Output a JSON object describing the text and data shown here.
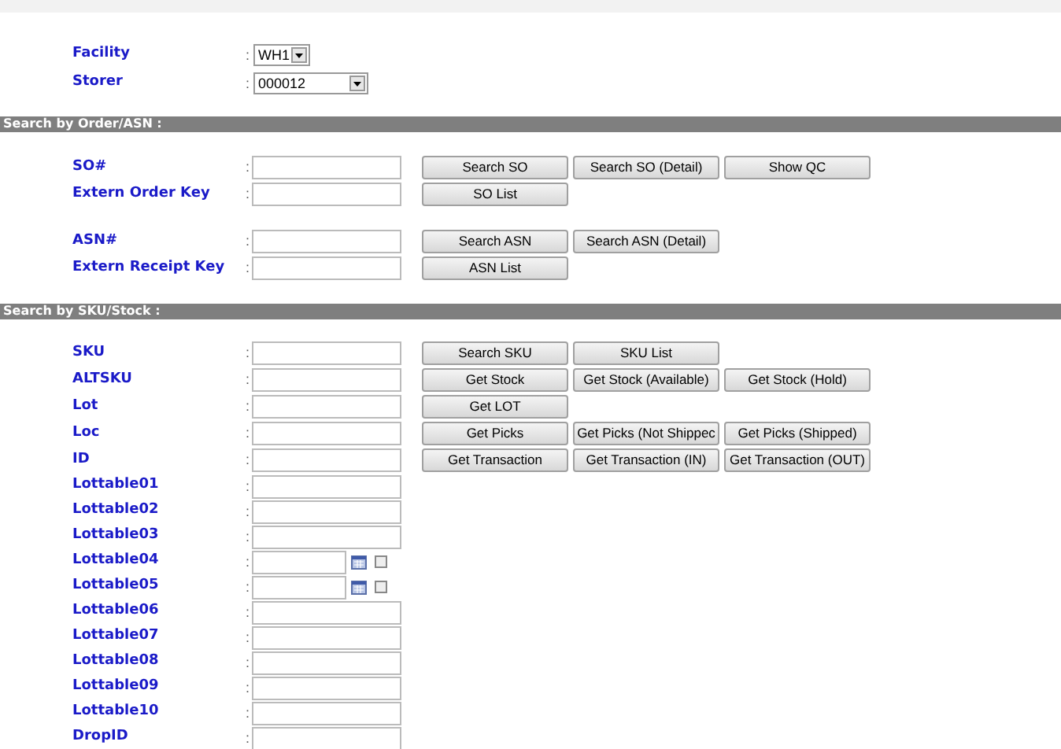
{
  "settings": [
    {
      "label": "Facility",
      "separator": ":",
      "value": "WH1"
    },
    {
      "label": "Storer",
      "separator": ":",
      "value": "000012"
    }
  ],
  "sections": [
    {
      "title": "Search by Order/ASN :",
      "groups": [
        [
          {
            "label": "SO#",
            "separator": ":",
            "kind": "text",
            "buttons": [
              "Search SO",
              "Search SO (Detail)",
              "Show QC"
            ]
          },
          {
            "label": "Extern Order Key",
            "separator": ":",
            "kind": "text",
            "buttons": [
              "SO List"
            ]
          }
        ],
        [
          {
            "label": "ASN#",
            "separator": ":",
            "kind": "text",
            "buttons": [
              "Search ASN",
              "Search ASN (Detail)"
            ]
          },
          {
            "label": "Extern Receipt Key",
            "separator": ":",
            "kind": "text",
            "buttons": [
              "ASN List"
            ]
          }
        ]
      ]
    },
    {
      "title": "Search by SKU/Stock :",
      "groups": [
        [
          {
            "label": "SKU",
            "separator": ":",
            "kind": "text",
            "buttons": [
              "Search SKU",
              "SKU List"
            ]
          },
          {
            "label": "ALTSKU",
            "separator": ":",
            "kind": "text",
            "buttons": [
              "Get Stock",
              "Get Stock (Available)",
              "Get Stock (Hold)"
            ]
          },
          {
            "label": "Lot",
            "separator": ":",
            "kind": "text",
            "buttons": [
              "Get LOT"
            ]
          },
          {
            "label": "Loc",
            "separator": ":",
            "kind": "text",
            "buttons": [
              "Get Picks",
              "Get Picks (Not Shippec",
              "Get Picks (Shipped)"
            ]
          },
          {
            "label": "ID",
            "separator": ":",
            "kind": "text",
            "buttons": [
              "Get Transaction",
              "Get Transaction (IN)",
              "Get Transaction (OUT)"
            ]
          },
          {
            "label": "Lottable01",
            "separator": ":",
            "kind": "text"
          },
          {
            "label": "Lottable02",
            "separator": ":",
            "kind": "text"
          },
          {
            "label": "Lottable03",
            "separator": ":",
            "kind": "text"
          },
          {
            "label": "Lottable04",
            "separator": ":",
            "kind": "date",
            "checked": false
          },
          {
            "label": "Lottable05",
            "separator": ":",
            "kind": "date",
            "checked": false
          },
          {
            "label": "Lottable06",
            "separator": ":",
            "kind": "text"
          },
          {
            "label": "Lottable07",
            "separator": ":",
            "kind": "text"
          },
          {
            "label": "Lottable08",
            "separator": ":",
            "kind": "text"
          },
          {
            "label": "Lottable09",
            "separator": ":",
            "kind": "text"
          },
          {
            "label": "Lottable10",
            "separator": ":",
            "kind": "text"
          },
          {
            "label": "DropID",
            "separator": ":",
            "kind": "text"
          }
        ]
      ]
    }
  ]
}
